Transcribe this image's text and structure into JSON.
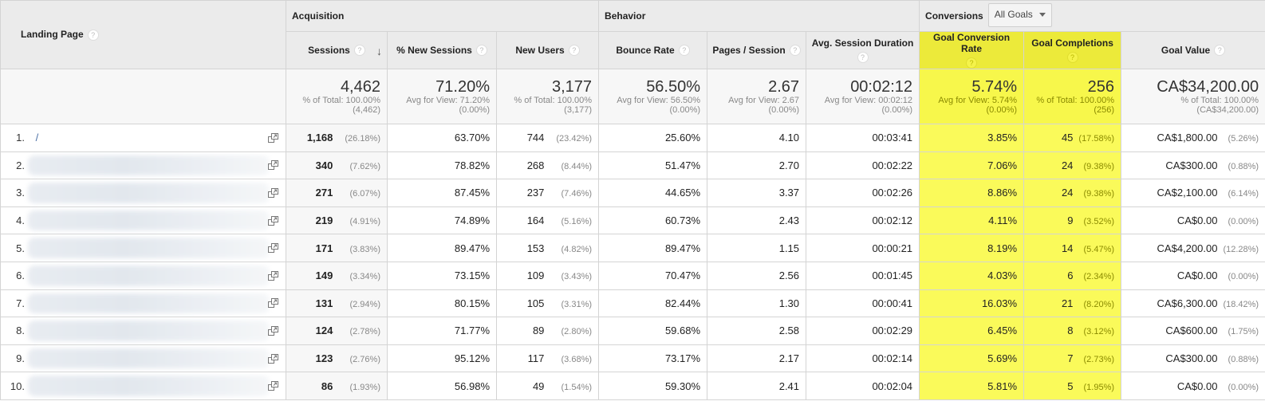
{
  "header": {
    "landing_page_label": "Landing Page",
    "groups": {
      "acquisition": "Acquisition",
      "behavior": "Behavior",
      "conversions": "Conversions",
      "goal_selector": "All Goals"
    },
    "columns": {
      "sessions": "Sessions",
      "pct_new_sessions": "% New Sessions",
      "new_users": "New Users",
      "bounce_rate": "Bounce Rate",
      "pages_session": "Pages / Session",
      "avg_session_duration": "Avg. Session Duration",
      "goal_conversion_rate": "Goal Conversion Rate",
      "goal_completions": "Goal Completions",
      "goal_value": "Goal Value"
    },
    "help_glyph": "?",
    "sort_glyph": "↓"
  },
  "highlight_color": "#f7f74b",
  "summary": {
    "sessions": {
      "value": "4,462",
      "line1": "% of Total: 100.00%",
      "line2": "(4,462)"
    },
    "pct_new_sessions": {
      "value": "71.20%",
      "line1": "Avg for View: 71.20%",
      "line2": "(0.00%)"
    },
    "new_users": {
      "value": "3,177",
      "line1": "% of Total: 100.00%",
      "line2": "(3,177)"
    },
    "bounce_rate": {
      "value": "56.50%",
      "line1": "Avg for View: 56.50%",
      "line2": "(0.00%)"
    },
    "pages_session": {
      "value": "2.67",
      "line1": "Avg for View: 2.67",
      "line2": "(0.00%)"
    },
    "avg_session_duration": {
      "value": "00:02:12",
      "line1": "Avg for View: 00:02:12",
      "line2": "(0.00%)"
    },
    "goal_conversion_rate": {
      "value": "5.74%",
      "line1": "Avg for View: 5.74%",
      "line2": "(0.00%)"
    },
    "goal_completions": {
      "value": "256",
      "line1": "% of Total: 100.00%",
      "line2": "(256)"
    },
    "goal_value": {
      "value": "CA$34,200.00",
      "line1": "% of Total: 100.00%",
      "line2": "(CA$34,200.00)"
    }
  },
  "rows": [
    {
      "index": "1.",
      "page": "/",
      "blurred": false,
      "sessions": "1,168",
      "sessions_pct": "(26.18%)",
      "pct_new": "63.70%",
      "new_users": "744",
      "new_users_pct": "(23.42%)",
      "bounce": "25.60%",
      "pages": "4.10",
      "duration": "00:03:41",
      "conv_rate": "3.85%",
      "completions": "45",
      "completions_pct": "(17.58%)",
      "value": "CA$1,800.00",
      "value_pct": "(5.26%)"
    },
    {
      "index": "2.",
      "page": "",
      "blurred": true,
      "sessions": "340",
      "sessions_pct": "(7.62%)",
      "pct_new": "78.82%",
      "new_users": "268",
      "new_users_pct": "(8.44%)",
      "bounce": "51.47%",
      "pages": "2.70",
      "duration": "00:02:22",
      "conv_rate": "7.06%",
      "completions": "24",
      "completions_pct": "(9.38%)",
      "value": "CA$300.00",
      "value_pct": "(0.88%)"
    },
    {
      "index": "3.",
      "page": "",
      "blurred": true,
      "sessions": "271",
      "sessions_pct": "(6.07%)",
      "pct_new": "87.45%",
      "new_users": "237",
      "new_users_pct": "(7.46%)",
      "bounce": "44.65%",
      "pages": "3.37",
      "duration": "00:02:26",
      "conv_rate": "8.86%",
      "completions": "24",
      "completions_pct": "(9.38%)",
      "value": "CA$2,100.00",
      "value_pct": "(6.14%)"
    },
    {
      "index": "4.",
      "page": "",
      "blurred": true,
      "sessions": "219",
      "sessions_pct": "(4.91%)",
      "pct_new": "74.89%",
      "new_users": "164",
      "new_users_pct": "(5.16%)",
      "bounce": "60.73%",
      "pages": "2.43",
      "duration": "00:02:12",
      "conv_rate": "4.11%",
      "completions": "9",
      "completions_pct": "(3.52%)",
      "value": "CA$0.00",
      "value_pct": "(0.00%)"
    },
    {
      "index": "5.",
      "page": "",
      "blurred": true,
      "sessions": "171",
      "sessions_pct": "(3.83%)",
      "pct_new": "89.47%",
      "new_users": "153",
      "new_users_pct": "(4.82%)",
      "bounce": "89.47%",
      "pages": "1.15",
      "duration": "00:00:21",
      "conv_rate": "8.19%",
      "completions": "14",
      "completions_pct": "(5.47%)",
      "value": "CA$4,200.00",
      "value_pct": "(12.28%)"
    },
    {
      "index": "6.",
      "page": "",
      "blurred": true,
      "sessions": "149",
      "sessions_pct": "(3.34%)",
      "pct_new": "73.15%",
      "new_users": "109",
      "new_users_pct": "(3.43%)",
      "bounce": "70.47%",
      "pages": "2.56",
      "duration": "00:01:45",
      "conv_rate": "4.03%",
      "completions": "6",
      "completions_pct": "(2.34%)",
      "value": "CA$0.00",
      "value_pct": "(0.00%)"
    },
    {
      "index": "7.",
      "page": "",
      "blurred": true,
      "sessions": "131",
      "sessions_pct": "(2.94%)",
      "pct_new": "80.15%",
      "new_users": "105",
      "new_users_pct": "(3.31%)",
      "bounce": "82.44%",
      "pages": "1.30",
      "duration": "00:00:41",
      "conv_rate": "16.03%",
      "completions": "21",
      "completions_pct": "(8.20%)",
      "value": "CA$6,300.00",
      "value_pct": "(18.42%)"
    },
    {
      "index": "8.",
      "page": "",
      "blurred": true,
      "sessions": "124",
      "sessions_pct": "(2.78%)",
      "pct_new": "71.77%",
      "new_users": "89",
      "new_users_pct": "(2.80%)",
      "bounce": "59.68%",
      "pages": "2.58",
      "duration": "00:02:29",
      "conv_rate": "6.45%",
      "completions": "8",
      "completions_pct": "(3.12%)",
      "value": "CA$600.00",
      "value_pct": "(1.75%)"
    },
    {
      "index": "9.",
      "page": "",
      "blurred": true,
      "sessions": "123",
      "sessions_pct": "(2.76%)",
      "pct_new": "95.12%",
      "new_users": "117",
      "new_users_pct": "(3.68%)",
      "bounce": "73.17%",
      "pages": "2.17",
      "duration": "00:02:14",
      "conv_rate": "5.69%",
      "completions": "7",
      "completions_pct": "(2.73%)",
      "value": "CA$300.00",
      "value_pct": "(0.88%)"
    },
    {
      "index": "10.",
      "page": "",
      "blurred": true,
      "sessions": "86",
      "sessions_pct": "(1.93%)",
      "pct_new": "56.98%",
      "new_users": "49",
      "new_users_pct": "(1.54%)",
      "bounce": "59.30%",
      "pages": "2.41",
      "duration": "00:02:04",
      "conv_rate": "5.81%",
      "completions": "5",
      "completions_pct": "(1.95%)",
      "value": "CA$0.00",
      "value_pct": "(0.00%)"
    }
  ]
}
